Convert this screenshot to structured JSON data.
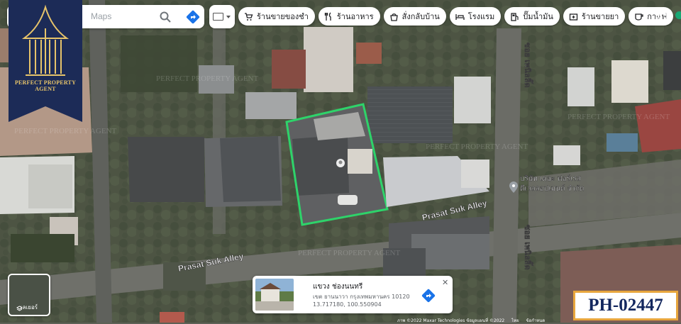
{
  "search": {
    "placeholder": "Maps"
  },
  "categories": [
    {
      "icon": "cart-icon",
      "label": "ร้านขายของชำ"
    },
    {
      "icon": "restaurant-icon",
      "label": "ร้านอาหาร"
    },
    {
      "icon": "takeout-icon",
      "label": "สั่งกลับบ้าน"
    },
    {
      "icon": "hotel-icon",
      "label": "โรงแรม"
    },
    {
      "icon": "gas-station-icon",
      "label": "ปั๊มน้ำมัน"
    },
    {
      "icon": "pharmacy-icon",
      "label": "ร้านขายยา"
    },
    {
      "icon": "coffee-icon",
      "label": "กาแฟ"
    }
  ],
  "brand": {
    "name": "PERFECT PROPERTY AGENT",
    "color": "#e7c46a",
    "bg": "#1c2b57"
  },
  "map": {
    "streets": [
      "Prasat Suk Alley",
      "Prasat Suk Alley",
      "ซอย เพนิลลิ๊ด",
      "ซอย เพนิลลิ๊ด"
    ],
    "poi": {
      "label_line1": "บริษัท เดอะ ฟอร์เรส",
      "label_line2": "ดีเวลลอปเมนต์ จำกัด"
    },
    "watermark": "PERFECT PROPERTY AGENT",
    "highlight_color": "#2ed36a"
  },
  "layers": {
    "label": "เลเยอร์"
  },
  "place_card": {
    "line1": "แขวง ช่องนนทรี",
    "line2": "เขต ยานนาวา กรุงเทพมหานคร 10120",
    "line3": "13.717180, 100.550904"
  },
  "footer": {
    "attribution": "ภาพ ©2022 Maxar Technologies ข้อมูลแผนที่ ©2022",
    "terms": "ไทย",
    "privacy": "ข้อกำหนด"
  },
  "listing_code": "PH-02447"
}
